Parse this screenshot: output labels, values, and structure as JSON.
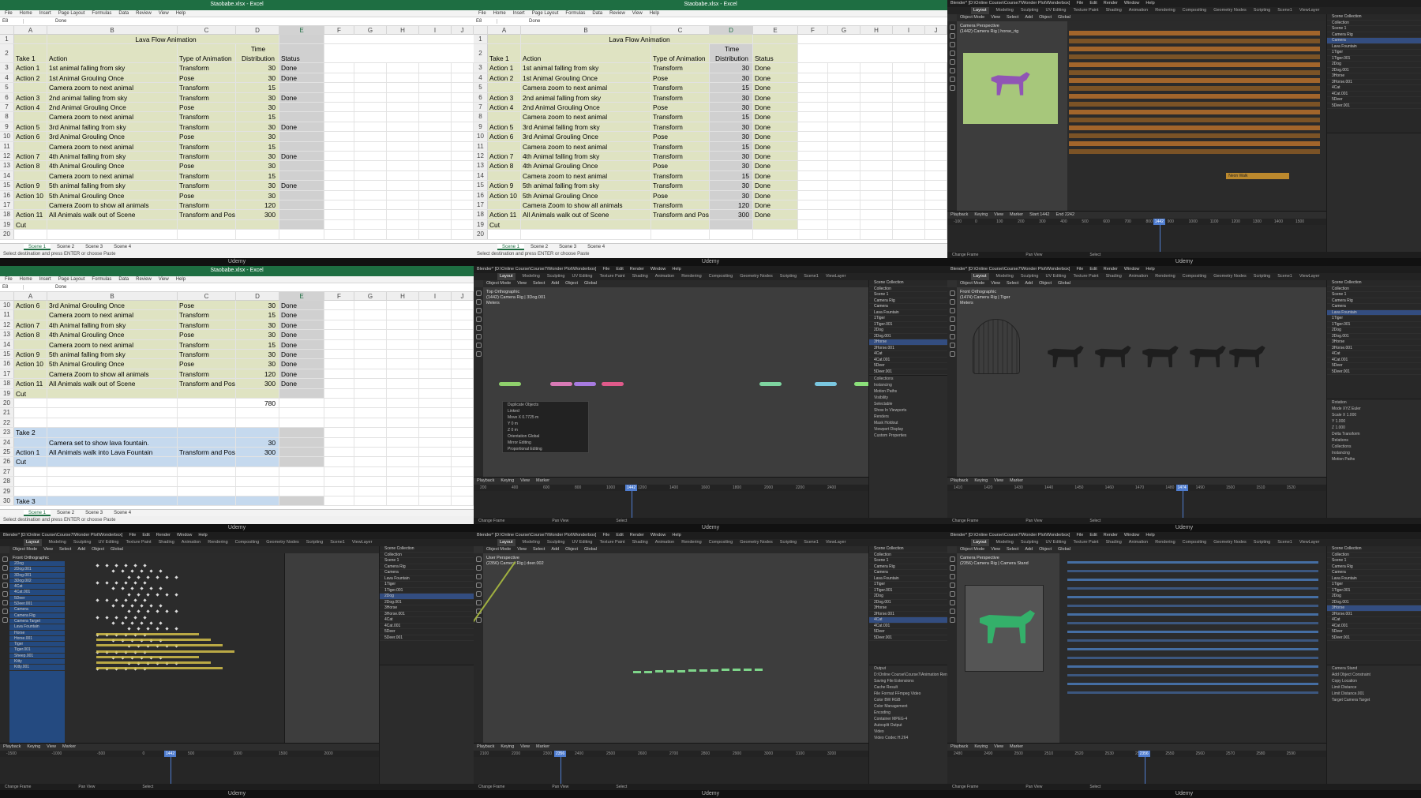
{
  "app": {
    "footer": "Udemy"
  },
  "excel1": {
    "window_title": "Staobabe.xlsx - Excel",
    "menu": [
      "File",
      "Home",
      "Insert",
      "Page Layout",
      "Formulas",
      "Data",
      "Review",
      "View",
      "Help"
    ],
    "namebox": "E8",
    "formula": "Done",
    "columns": [
      "A",
      "B",
      "C",
      "D",
      "E",
      "F",
      "G",
      "H",
      "I",
      "J"
    ],
    "title": "Lava Flow Animation",
    "head_time": "Time",
    "headers": [
      "Take 1",
      "Action",
      "Type of Animation",
      "Distribution",
      "Status"
    ],
    "rows": [
      [
        "3",
        "Action 1",
        "1st animal falling from sky",
        "Transform",
        "30",
        "Done"
      ],
      [
        "4",
        "Action 2",
        "1st Animal Grouling Once",
        "Pose",
        "30",
        "Done"
      ],
      [
        "5",
        "",
        "Camera zoom to next animal",
        "Transform",
        "15",
        ""
      ],
      [
        "6",
        "Action 3",
        "2nd animal falling from sky",
        "Transform",
        "30",
        "Done"
      ],
      [
        "7",
        "Action 4",
        "2nd Animal Grouling Once",
        "Pose",
        "30",
        ""
      ],
      [
        "8",
        "",
        "Camera zoom to next animal",
        "Transform",
        "15",
        ""
      ],
      [
        "9",
        "Action 5",
        "3rd Animal falling from sky",
        "Transform",
        "30",
        "Done"
      ],
      [
        "10",
        "Action 6",
        "3rd Animal Grouling Once",
        "Pose",
        "30",
        ""
      ],
      [
        "11",
        "",
        "Camera zoom to next animal",
        "Transform",
        "15",
        ""
      ],
      [
        "12",
        "Action 7",
        "4th Animal falling from sky",
        "Transform",
        "30",
        "Done"
      ],
      [
        "13",
        "Action 8",
        "4th Animal Grouling Once",
        "Pose",
        "30",
        ""
      ],
      [
        "14",
        "",
        "Camera zoom to next animal",
        "Transform",
        "15",
        ""
      ],
      [
        "15",
        "Action 9",
        "5th animal falling from sky",
        "Transform",
        "30",
        "Done"
      ],
      [
        "16",
        "Action 10",
        "5th Animal Grouling Once",
        "Pose",
        "30",
        ""
      ],
      [
        "17",
        "",
        "Camera Zoom to show all animals",
        "Transform",
        "120",
        ""
      ],
      [
        "18",
        "Action 11",
        "All Animals walk out of Scene",
        "Transform and Pose",
        "300",
        ""
      ],
      [
        "19",
        "Cut",
        "",
        "",
        "",
        ""
      ],
      [
        "20",
        "",
        "",
        "",
        "",
        ""
      ]
    ],
    "tabs": [
      "Scene 1",
      "Scene 2",
      "Scene 3",
      "Scene 4"
    ],
    "status": "Select destination and press ENTER or choose Paste"
  },
  "excel2": {
    "rows": [
      [
        "3",
        "Action 1",
        "1st animal falling from sky",
        "Transform",
        "30",
        "Done"
      ],
      [
        "4",
        "Action 2",
        "1st Animal Grouling Once",
        "Pose",
        "30",
        "Done"
      ],
      [
        "5",
        "",
        "Camera zoom to next animal",
        "Transform",
        "15",
        "Done"
      ],
      [
        "6",
        "Action 3",
        "2nd animal falling from sky",
        "Transform",
        "30",
        "Done"
      ],
      [
        "7",
        "Action 4",
        "2nd Animal Grouling Once",
        "Pose",
        "30",
        "Done"
      ],
      [
        "8",
        "",
        "Camera zoom to next animal",
        "Transform",
        "15",
        "Done"
      ],
      [
        "9",
        "Action 5",
        "3rd Animal falling from sky",
        "Transform",
        "30",
        "Done"
      ],
      [
        "10",
        "Action 6",
        "3rd Animal Grouling Once",
        "Pose",
        "30",
        "Done"
      ],
      [
        "11",
        "",
        "Camera zoom to next animal",
        "Transform",
        "15",
        "Done"
      ],
      [
        "12",
        "Action 7",
        "4th Animal falling from sky",
        "Transform",
        "30",
        "Done"
      ],
      [
        "13",
        "Action 8",
        "4th Animal Grouling Once",
        "Pose",
        "30",
        "Done"
      ],
      [
        "14",
        "",
        "Camera zoom to next animal",
        "Transform",
        "15",
        "Done"
      ],
      [
        "15",
        "Action 9",
        "5th animal falling from sky",
        "Transform",
        "30",
        "Done"
      ],
      [
        "16",
        "Action 10",
        "5th Animal Grouling Once",
        "Pose",
        "30",
        "Done"
      ],
      [
        "17",
        "",
        "Camera Zoom to show all animals",
        "Transform",
        "120",
        "Done"
      ],
      [
        "18",
        "Action 11",
        "All Animals walk out of Scene",
        "Transform and Pose",
        "300",
        "Done"
      ],
      [
        "19",
        "Cut",
        "",
        "",
        "",
        ""
      ],
      [
        "20",
        "",
        "",
        "",
        "",
        ""
      ]
    ]
  },
  "excel3": {
    "rows": [
      [
        "10",
        "Action 6",
        "3rd Animal Grouling Once",
        "Pose",
        "30",
        "Done",
        "s"
      ],
      [
        "11",
        "",
        "Camera zoom to next animal",
        "Transform",
        "15",
        "Done",
        "s"
      ],
      [
        "12",
        "Action 7",
        "4th Animal falling from sky",
        "Transform",
        "30",
        "Done",
        "s"
      ],
      [
        "13",
        "Action 8",
        "4th Animal Grouling Once",
        "Pose",
        "30",
        "Done",
        "s"
      ],
      [
        "14",
        "",
        "Camera zoom to next animal",
        "Transform",
        "15",
        "Done",
        "s"
      ],
      [
        "15",
        "Action 9",
        "5th animal falling from sky",
        "Transform",
        "30",
        "Done",
        "s"
      ],
      [
        "16",
        "Action 10",
        "5th Animal Grouling Once",
        "Pose",
        "30",
        "Done",
        "s"
      ],
      [
        "17",
        "",
        "Camera Zoom to show all animals",
        "Transform",
        "120",
        "Done",
        "s"
      ],
      [
        "18",
        "Action 11",
        "All Animals walk out of Scene",
        "Transform and Pose",
        "300",
        "Done",
        "s"
      ],
      [
        "19",
        "Cut",
        "",
        "",
        "",
        "",
        "s"
      ],
      [
        "20",
        "",
        "",
        "",
        "780",
        "",
        ""
      ],
      [
        "21",
        "",
        "",
        "",
        "",
        "",
        ""
      ],
      [
        "22",
        "",
        "",
        "",
        "",
        "",
        ""
      ],
      [
        "23",
        "Take 2",
        "",
        "",
        "",
        "",
        "b"
      ],
      [
        "24",
        "",
        "Camera set to show lava fountain.",
        "",
        "30",
        "",
        "b"
      ],
      [
        "25",
        "Action 1",
        "All Animals walk into Lava Fountain",
        "Transform and Pose",
        "300",
        "",
        "b"
      ],
      [
        "26",
        "Cut",
        "",
        "",
        "",
        "",
        "b"
      ],
      [
        "27",
        "",
        "",
        "",
        "",
        "",
        ""
      ],
      [
        "28",
        "",
        "",
        "",
        "",
        "",
        ""
      ],
      [
        "29",
        "",
        "",
        "",
        "",
        "",
        ""
      ],
      [
        "30",
        "Take 3",
        "",
        "",
        "",
        "",
        "b"
      ]
    ]
  },
  "blender": {
    "title": "Blender* [D:\\Online Course\\Course7\\Wonder Plot\\Wonderbox]",
    "menu": [
      "File",
      "Edit",
      "Render",
      "Window",
      "Help"
    ],
    "workspaces": [
      "Layout",
      "Modeling",
      "Sculpting",
      "UV Editing",
      "Texture Paint",
      "Shading",
      "Animation",
      "Rendering",
      "Compositing",
      "Geometry Nodes",
      "Scripting"
    ],
    "scene": "Scene1",
    "view_layer": "ViewLayer",
    "mode": "Object Mode",
    "view_menu": [
      "View",
      "Select",
      "Add",
      "Object"
    ],
    "transform": "Global",
    "tl_menu": [
      "Playback",
      "Keying",
      "View",
      "Marker"
    ],
    "outliner": [
      "Scene Collection",
      "Collection",
      "Scene 1",
      "Camera Rig",
      "Camera",
      "Lava Fountain",
      "1Tiger",
      "1Tiger.001",
      "2Dog",
      "2Dog.001",
      "3Horse",
      "3Horse.001",
      "4Cat",
      "4Cat.001",
      "5Deer",
      "5Deer.001"
    ],
    "status_left": "Change Frame",
    "status_mid": "Pan View",
    "status_right": "Select",
    "p1": {
      "info": "Camera Perspective\n(1442) Camera Rig | horse_rig",
      "frame": "1442",
      "ticks": [
        "-100",
        "0",
        "100",
        "200",
        "300",
        "400",
        "500",
        "600",
        "700",
        "800",
        "900",
        "1000",
        "1100",
        "1200",
        "1300",
        "1400",
        "1500"
      ],
      "strip": "Neon Walk",
      "start": "Start 1442",
      "end": "End 2242"
    },
    "p2": {
      "info": "Top Orthographic\n(1442) Camera Rig | 3Dog.001\nMeters",
      "frame": "1442",
      "ticks": [
        "200",
        "400",
        "600",
        "800",
        "1000",
        "1200",
        "1400",
        "1600",
        "1800",
        "2000",
        "2200",
        "2400"
      ],
      "redo": "Duplicate Objects",
      "redo_rows": [
        "Linked",
        "Move X  0.7725 m",
        "Y  0 m",
        "Z  0 m",
        "Orientation  Global",
        "Mirror Editing",
        "Proportional Editing"
      ],
      "props": [
        "Collections",
        "Instancing",
        "Motion Paths",
        "Visibility",
        "Selectable",
        "Show In  Viewports",
        "Renders",
        "Mask  Holdout",
        "Viewport Display",
        "Custom Properties"
      ]
    },
    "p3": {
      "info": "Front Orthographic\n(1474) Camera Rig | Tiger\nMeters",
      "frame": "1474",
      "ticks": [
        "1410",
        "1420",
        "1430",
        "1440",
        "1450",
        "1460",
        "1470",
        "1480",
        "1490",
        "1500",
        "1510",
        "1520"
      ],
      "props": [
        "Rotation",
        "Mode  XYZ Euler",
        "Scale X  1.000",
        "Y  1.000",
        "Z  1.000",
        "Delta Transform",
        "Relations",
        "Collections",
        "Instancing",
        "Motion Paths"
      ]
    },
    "p4": {
      "info": "Front Orthographic\n(1442) Camera Rig | Tiger\nMeters",
      "frame": "1442",
      "ticks": [
        "-1500",
        "-1000",
        "-500",
        "0",
        "500",
        "1000",
        "1500",
        "2000"
      ],
      "channels": [
        "2Dog",
        "2Dog.001",
        "3Dog.001",
        "3Dog.002",
        "4Cat",
        "4Cat.001",
        "5Deer",
        "5Deer.001",
        "Camera",
        "Camera Rig",
        "Camera Target",
        "Lava Fountain",
        "Horse",
        "Horse.001",
        "Tiger",
        "Tiger.001",
        "Sheep.001",
        "Kitty",
        "Kitty.001"
      ]
    },
    "p5": {
      "info": "User Perspective\n(2356) Camera Rig | deer.002",
      "frame": "2356",
      "ticks": [
        "2100",
        "2200",
        "2300",
        "2400",
        "2500",
        "2600",
        "2700",
        "2800",
        "2900",
        "3000",
        "3100",
        "3200"
      ],
      "props": [
        "Output",
        "D:\\Online Course\\Course7\\Animation Render\\",
        "Saving  File Extensions",
        "Cache Result",
        "File Format  FFmpeg Video",
        "Color  BW  RGB",
        "Color Management",
        "Encoding",
        "Container  MPEG-4",
        "Autosplit Output",
        "Video",
        "Video Codec  H.264"
      ]
    },
    "p6": {
      "info": "Camera Perspective\n(2356) Camera Rig | Camera Stand",
      "frame": "2356",
      "ticks": [
        "2480",
        "2490",
        "2500",
        "2510",
        "2520",
        "2530",
        "2540",
        "2550",
        "2560",
        "2570",
        "2580",
        "2590"
      ],
      "props": [
        "Camera Stand",
        "Add Object Constraint",
        "Copy Location",
        "Limit Distance",
        "Limit Distance.001",
        "Target  Camera Target"
      ]
    }
  },
  "colors": {
    "excel_green": "#1e6e42",
    "shade": "#dfe3c2",
    "take_blue": "#c5d9ee",
    "blender_blue": "#4f7dd0",
    "strip": "#d69a2e"
  }
}
